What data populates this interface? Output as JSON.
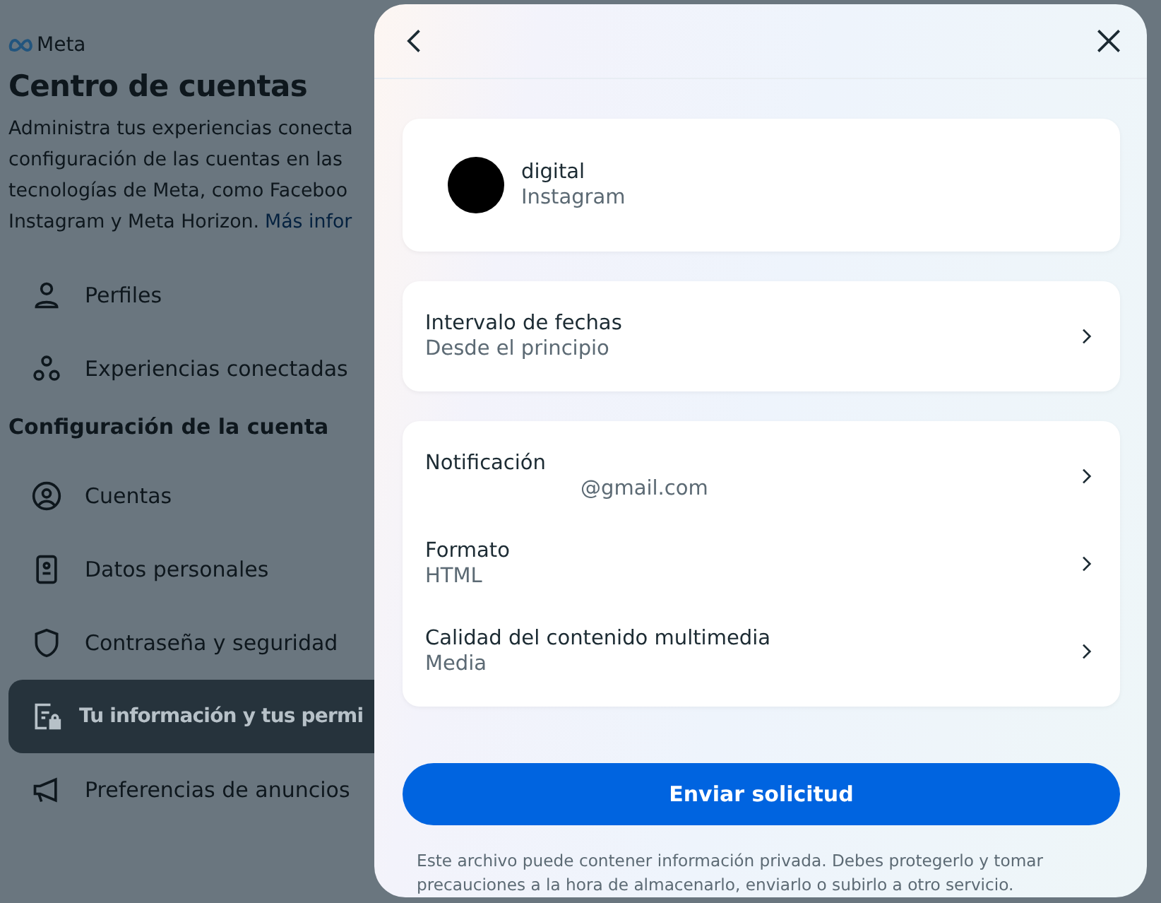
{
  "page": {
    "brand": "Meta",
    "title": "Centro de cuentas",
    "description_lines": [
      "Administra tus experiencias conecta",
      "configuración de las cuentas en las",
      "tecnologías de Meta, como Faceboo",
      "Instagram y Meta Horizon."
    ],
    "description_link": "Más infor",
    "nav": [
      {
        "label": "Perfiles",
        "selected": false
      },
      {
        "label": "Experiencias conectadas",
        "selected": false
      }
    ],
    "section": "Configuración de la cuenta",
    "settings": [
      {
        "label": "Cuentas",
        "selected": false
      },
      {
        "label": "Datos personales",
        "selected": false
      },
      {
        "label": "Contraseña y seguridad",
        "selected": false
      },
      {
        "label": "Tu información y tus permi",
        "selected": true
      },
      {
        "label": "Preferencias de anuncios",
        "selected": false
      }
    ]
  },
  "dialog": {
    "profile": {
      "name": "digital",
      "platform": "Instagram"
    },
    "date_range": {
      "label": "Intervalo de fechas",
      "value": "Desde el principio"
    },
    "options": [
      {
        "label": "Notificación",
        "value": "@gmail.com"
      },
      {
        "label": "Formato",
        "value": "HTML"
      },
      {
        "label": "Calidad del contenido multimedia",
        "value": "Media"
      }
    ],
    "submit": "Enviar solicitud",
    "note": "Este archivo puede contener información privada. Debes protegerlo y tomar precauciones a la hora de almacenarlo, enviarlo o subirlo a otro servicio."
  }
}
